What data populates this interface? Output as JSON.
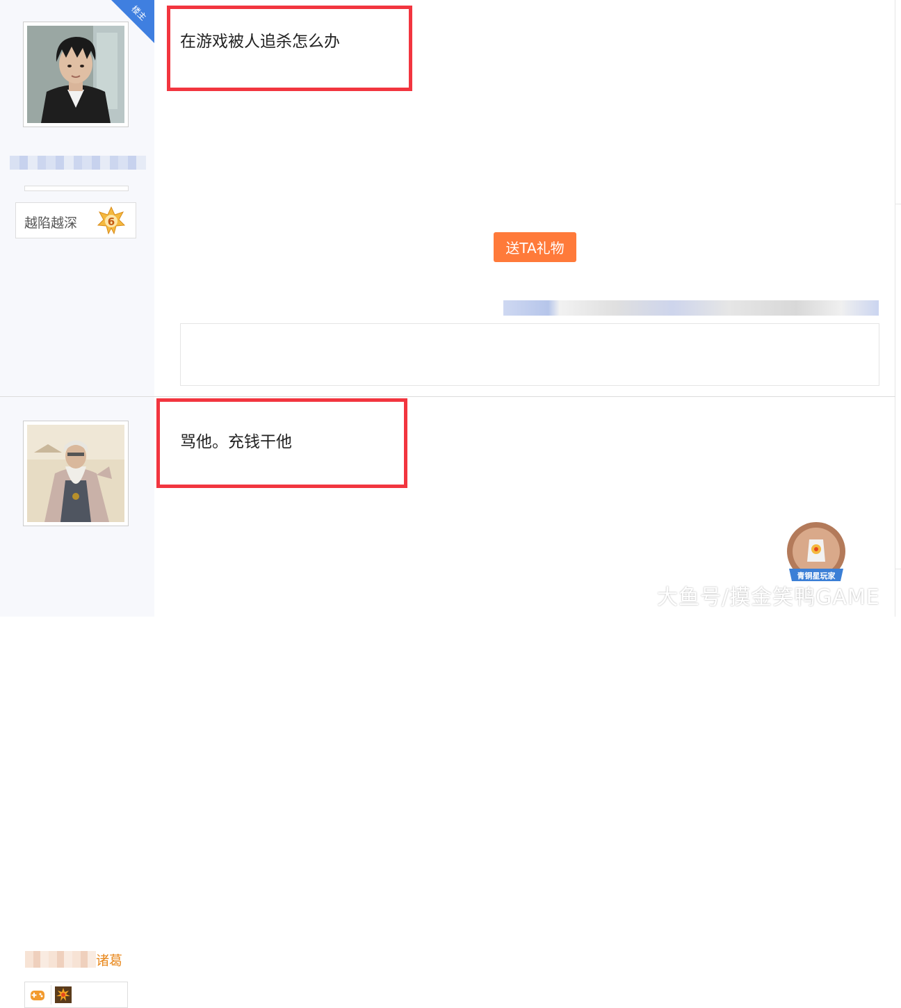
{
  "posts": [
    {
      "badge": "楼主",
      "rank_title": "越陷越深",
      "level": "6",
      "content": "在游戏被人追杀怎么办",
      "gift_button": "送TA礼物"
    },
    {
      "author_suffix": "诸葛",
      "content": "骂他。充钱干他"
    }
  ],
  "bronze_badge": "青铜星玩家",
  "watermark": "大鱼号/摸金笑鸭GAME",
  "colors": {
    "highlight": "#f2353f",
    "gift": "#ff7a3a",
    "username": "#e8891f"
  }
}
